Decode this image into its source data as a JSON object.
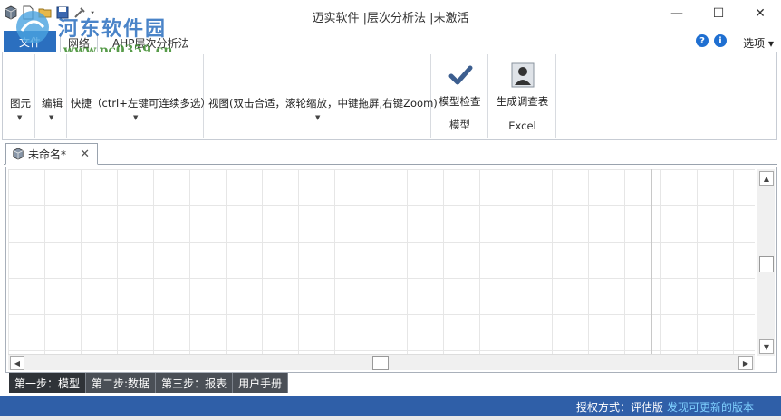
{
  "window": {
    "title": "迈实软件 |层次分析法 |未激活",
    "minimize_symbol": "—",
    "maximize_symbol": "☐",
    "close_symbol": "✕"
  },
  "watermark": {
    "site_name": "河东软件园",
    "url": "www.pc0359.cn"
  },
  "quick_access": {
    "icons": [
      "app-cube-icon",
      "new-file-icon",
      "open-folder-icon",
      "save-icon",
      "tools-icon",
      "dropdown-icon"
    ]
  },
  "ribbon_tabs": {
    "file_label": "文件",
    "tabs": [
      {
        "label": "网络"
      },
      {
        "label": "AHP层次分析法"
      }
    ],
    "help_symbol": "?",
    "info_symbol": "i",
    "options_label": "选项 ▾"
  },
  "ribbon": {
    "groups": [
      {
        "label": "图元",
        "arrow": "▼"
      },
      {
        "label": "编辑",
        "arrow": "▼"
      },
      {
        "label": "快捷（ctrl+左键可连续多选）",
        "arrow": "▼"
      },
      {
        "label": "视图(双击合适，滚轮缩放，中键拖屏,右键Zoom)",
        "arrow": "▼"
      }
    ],
    "model_check": {
      "label": "模型检查",
      "group": "模型"
    },
    "survey": {
      "label": "生成调查表",
      "group": "Excel"
    }
  },
  "document": {
    "tab_label": "未命名*",
    "close_symbol": "✕"
  },
  "scroll": {
    "up": "▲",
    "down": "▼",
    "left": "◀",
    "right": "▶"
  },
  "steps": [
    {
      "label": "第一步：模型"
    },
    {
      "label": "第二步:数据"
    },
    {
      "label": "第三步：报表"
    },
    {
      "label": "用户手册"
    }
  ],
  "status": {
    "license": "授权方式：评估版",
    "update": "发现可更新的版本"
  },
  "colors": {
    "accent": "#2b6fbf",
    "statusbar": "#2f5fa8",
    "step_tab": "#4a4f56"
  }
}
